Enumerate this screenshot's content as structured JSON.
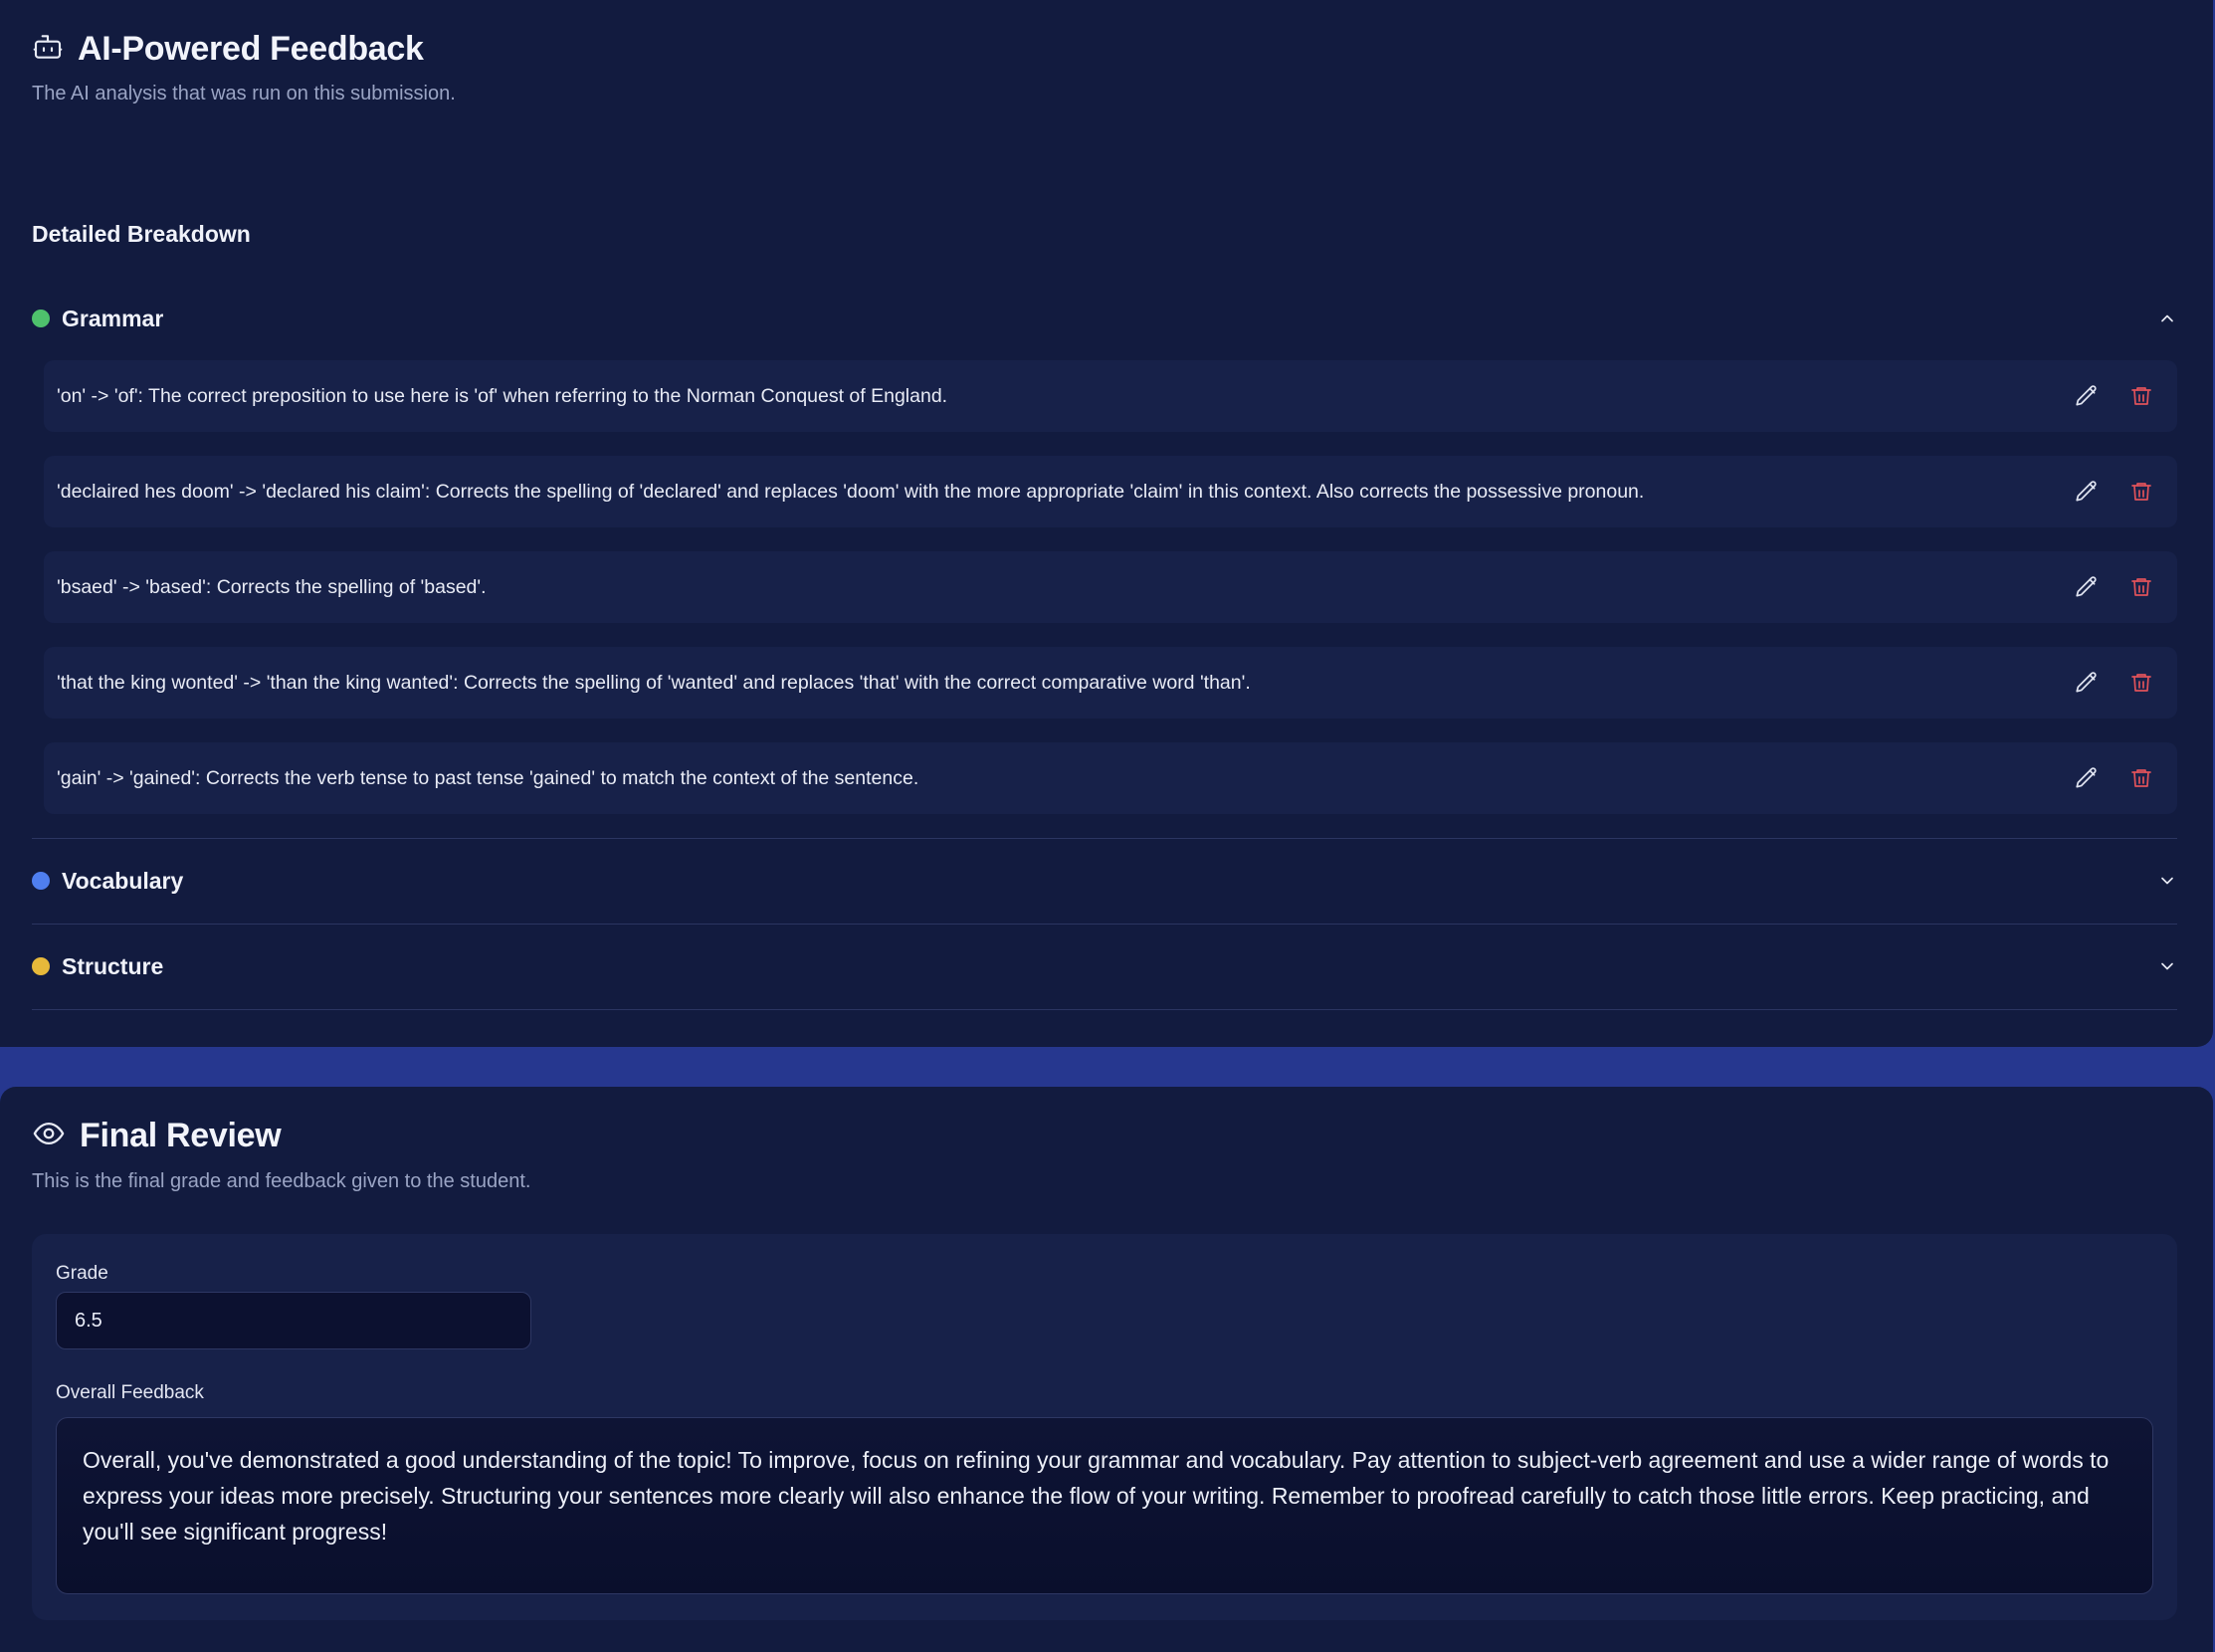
{
  "ai_feedback": {
    "title": "AI-Powered Feedback",
    "subtitle": "The AI analysis that was run on this submission.",
    "icon": "robot-icon",
    "breakdown_label": "Detailed Breakdown",
    "categories": [
      {
        "name": "Grammar",
        "color": "#4ec16c",
        "expanded": true,
        "items": [
          "'on' -> 'of': The correct preposition to use here is 'of' when referring to the Norman Conquest of England.",
          "'declaired hes doom' -> 'declared his claim': Corrects the spelling of 'declared' and replaces 'doom' with the more appropriate 'claim' in this context. Also corrects the possessive pronoun.",
          "'bsaed' -> 'based': Corrects the spelling of 'based'.",
          "'that the king wonted' -> 'than the king wanted': Corrects the spelling of 'wanted' and replaces 'that' with the correct comparative word 'than'.",
          "'gain' -> 'gained': Corrects the verb tense to past tense 'gained' to match the context of the sentence."
        ]
      },
      {
        "name": "Vocabulary",
        "color": "#4f7ff0",
        "expanded": false,
        "items": []
      },
      {
        "name": "Structure",
        "color": "#e7b93a",
        "expanded": false,
        "items": []
      }
    ]
  },
  "final_review": {
    "title": "Final Review",
    "subtitle": "This is the final grade and feedback given to the student.",
    "icon": "eye-icon",
    "grade_label": "Grade",
    "grade_value": "6.5",
    "feedback_label": "Overall Feedback",
    "feedback_value": "Overall, you've demonstrated a good understanding of the topic! To improve, focus on refining your grammar and vocabulary. Pay attention to subject-verb agreement and use a wider range of words to express your ideas more precisely. Structuring your sentences more clearly will also enhance the flow of your writing. Remember to proofread carefully to catch those little errors. Keep practicing, and you'll see significant progress!"
  },
  "colors": {
    "card_bg": "#121b3f",
    "page_bg": "#26378f",
    "item_bg": "#172149",
    "delete": "#e0525a"
  }
}
